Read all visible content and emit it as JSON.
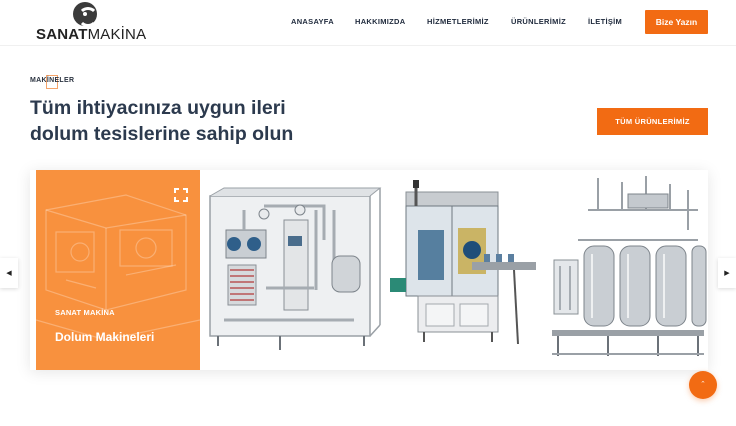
{
  "brand": {
    "name_bold": "SANAT",
    "name_light": "MAKİNA"
  },
  "nav": {
    "items": [
      "ANASAYFA",
      "HAKKIMIZDA",
      "HİZMETLERİMİZ",
      "ÜRÜNLERİMİZ",
      "İLETİŞİM"
    ],
    "cta": "Bize Yazın"
  },
  "section": {
    "eyebrow": "MAKİNELER",
    "headline_line1": "Tüm ihtiyacınıza uygun ileri",
    "headline_line2": "dolum tesislerine sahip olun",
    "all_products": "TÜM ÜRÜNLERİMİZ"
  },
  "carousel": {
    "feature": {
      "subtitle": "SANAT MAKİNA",
      "title": "Dolum Makineleri"
    },
    "slides": [
      "pasteurizer-machine-image",
      "labeling-machine-image",
      "tank-system-image"
    ]
  },
  "icons": {
    "expand": "expand-icon",
    "prev": "chevron-left-icon",
    "next": "chevron-right-icon",
    "top": "chevron-up-icon"
  },
  "colors": {
    "accent": "#f26b13",
    "feature": "#f8913e",
    "heading": "#2c3a4e"
  }
}
